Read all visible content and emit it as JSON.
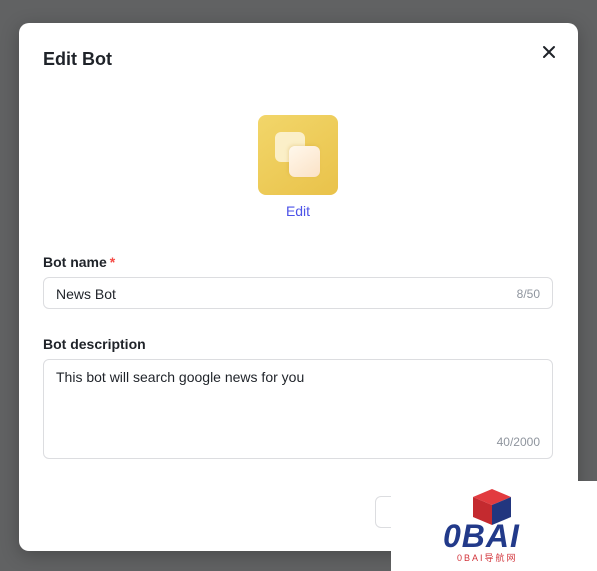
{
  "modal": {
    "title": "Edit Bot",
    "close_icon": "close-icon",
    "avatar_icon": "bot-avatar-icon",
    "edit_label": "Edit"
  },
  "bot_name": {
    "label": "Bot name",
    "required_mark": "*",
    "value": "News Bot",
    "counter": "8/50"
  },
  "bot_description": {
    "label": "Bot description",
    "value": "This bot will search google news for you",
    "counter": "40/2000"
  },
  "watermark": {
    "text": "0BAI",
    "sub_text": "0BAI导航网"
  },
  "colors": {
    "accent": "#4d53e8",
    "required": "#f54a45",
    "avatar_bg": "#ecc850",
    "overlay": "#616263"
  }
}
